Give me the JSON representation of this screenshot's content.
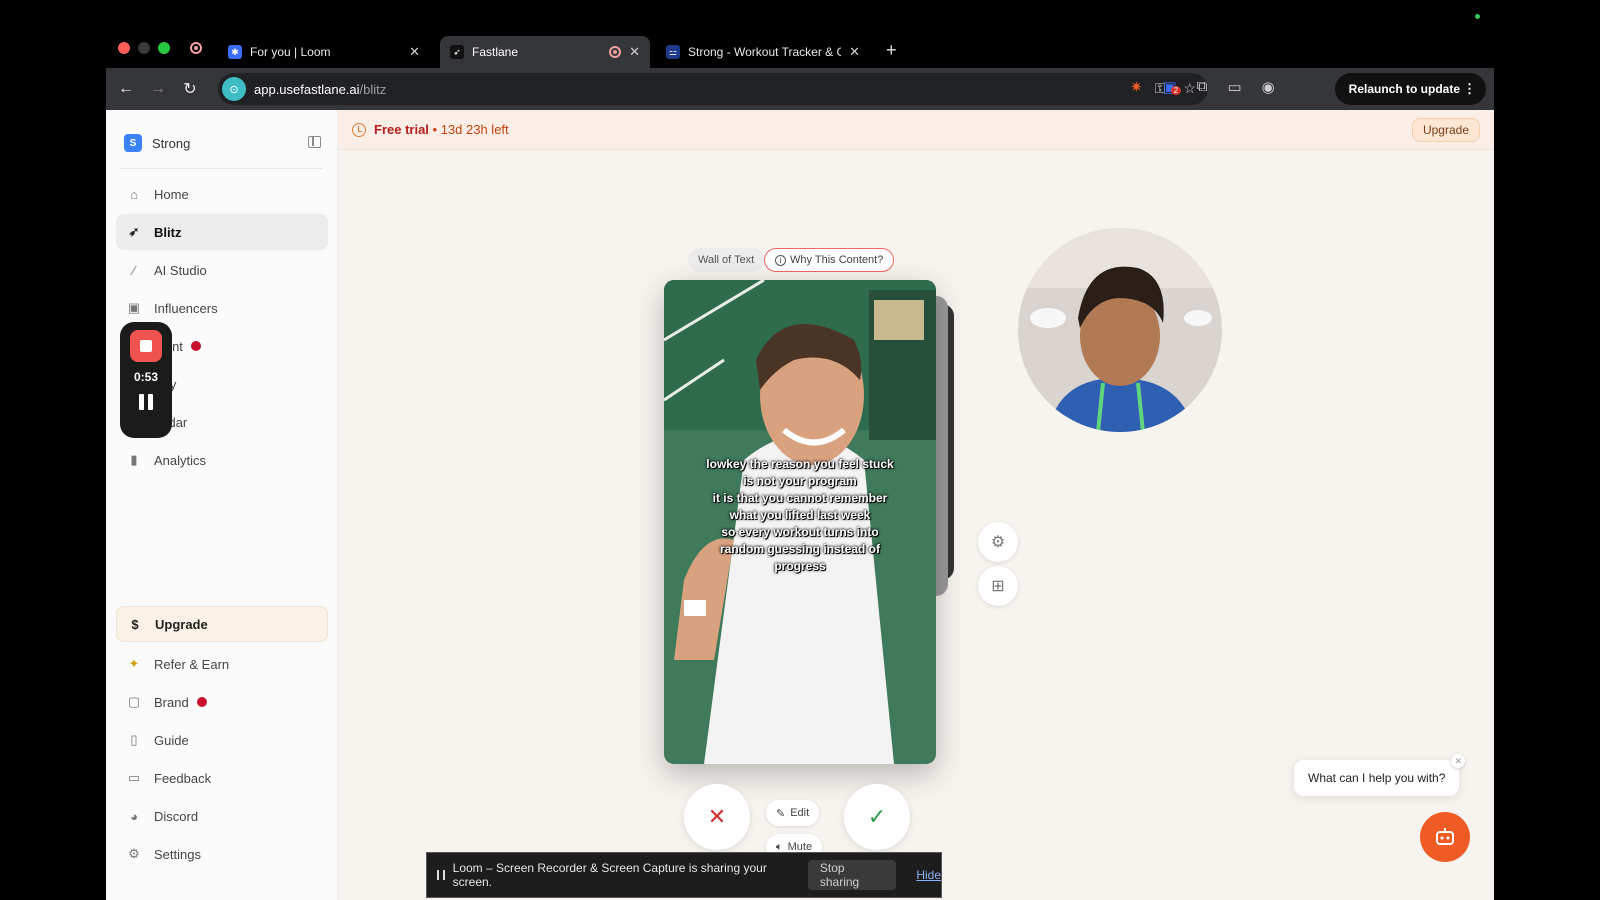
{
  "browser": {
    "tabs": [
      {
        "title": "For you | Loom",
        "icon": "loom-icon",
        "color": "#625df5"
      },
      {
        "title": "Fastlane",
        "icon": "fastlane-icon",
        "color": "#222222"
      },
      {
        "title": "Strong - Workout Tracker & G",
        "icon": "strong-icon",
        "color": "#3b82f6"
      }
    ],
    "url_host": "app.usefastlane.ai",
    "url_path": "/blitz",
    "relaunch_label": "Relaunch to update",
    "ext_badge": "2"
  },
  "sidebar": {
    "workspace_badge": "S",
    "workspace_name": "Strong",
    "items": [
      {
        "label": "Home",
        "icon": "home-icon"
      },
      {
        "label": "Blitz",
        "icon": "rocket-icon",
        "active": true
      },
      {
        "label": "AI Studio",
        "icon": "magic-wand-icon"
      },
      {
        "label": "Influencers",
        "icon": "user-square-icon"
      },
      {
        "label": "ntent",
        "icon": "content-icon",
        "dot": true
      },
      {
        "label": "rary",
        "icon": "library-icon"
      },
      {
        "label": "endar",
        "icon": "calendar-icon"
      },
      {
        "label": "Analytics",
        "icon": "chart-icon"
      }
    ],
    "bottom_items": [
      {
        "label": "Upgrade",
        "icon": "dollar-icon",
        "highlight": true
      },
      {
        "label": "Refer & Earn",
        "icon": "gift-icon"
      },
      {
        "label": "Brand",
        "icon": "briefcase-icon",
        "dot": true
      },
      {
        "label": "Guide",
        "icon": "map-icon"
      },
      {
        "label": "Feedback",
        "icon": "chat-square-icon"
      },
      {
        "label": "Discord",
        "icon": "discord-icon"
      },
      {
        "label": "Settings",
        "icon": "gear-icon"
      }
    ]
  },
  "loom_widget": {
    "time": "0:53"
  },
  "trial": {
    "label": "Free trial",
    "remaining": " • 13d 23h left",
    "upgrade": "Upgrade"
  },
  "pills": {
    "wall": "Wall of Text",
    "why": "Why This Content?"
  },
  "video": {
    "caption_lines": [
      "lowkey the reason you feel stuck",
      "is not your program",
      "it is that you cannot remember",
      "what you lifted last week",
      "so every workout turns into",
      "random guessing instead of",
      "progress"
    ]
  },
  "actions": {
    "edit": "Edit",
    "mute": "Mute"
  },
  "share_bar": {
    "message": "Loom – Screen Recorder & Screen Capture is sharing your screen.",
    "stop": "Stop sharing",
    "hide": "Hide"
  },
  "chat": {
    "prompt": "What can I help you with?"
  },
  "colors": {
    "brand_orange": "#ef5b25",
    "reject_red": "#d32f2f",
    "accept_green": "#2e9d4b",
    "alert_red": "#c8102e"
  }
}
